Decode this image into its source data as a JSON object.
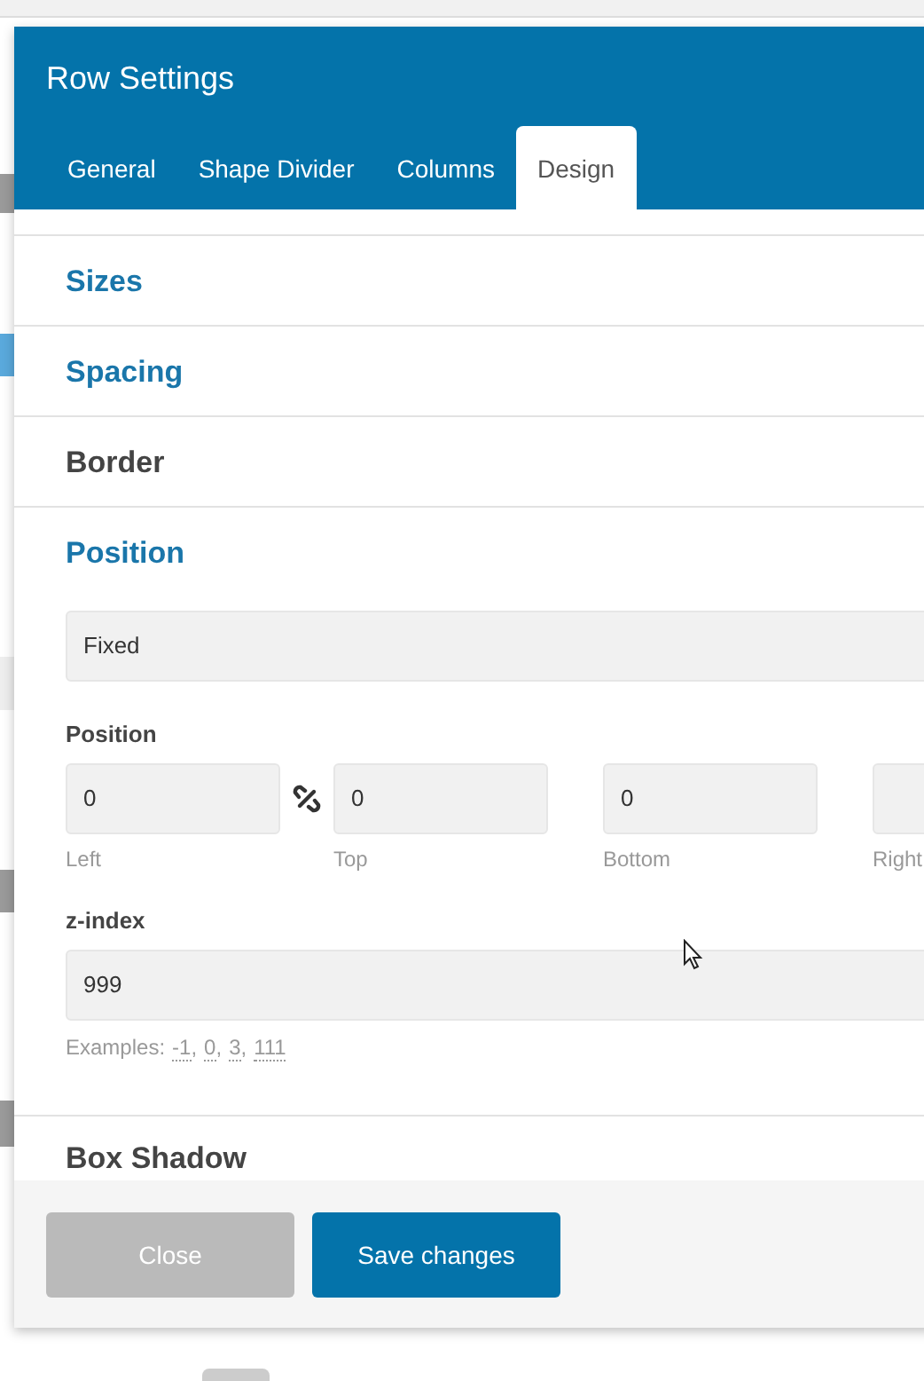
{
  "window": {
    "title": "Row Settings"
  },
  "tabs": [
    {
      "label": "General",
      "selected": false
    },
    {
      "label": "Shape Divider",
      "selected": false
    },
    {
      "label": "Columns",
      "selected": false
    },
    {
      "label": "Design",
      "selected": true
    }
  ],
  "sections": [
    {
      "title": "Sizes",
      "expanded": false,
      "hovered": false
    },
    {
      "title": "Spacing",
      "expanded": false,
      "hovered": false
    },
    {
      "title": "Border",
      "expanded": false,
      "hovered": true
    },
    {
      "title": "Position",
      "expanded": true,
      "hovered": false
    }
  ],
  "position": {
    "type_select": {
      "value": "Fixed"
    },
    "offsets_label": "Position",
    "linked": false,
    "offsets": [
      {
        "label": "Left",
        "value": "0"
      },
      {
        "label": "Top",
        "value": "0"
      },
      {
        "label": "Bottom",
        "value": "0"
      },
      {
        "label": "Right"
      }
    ],
    "z_index": {
      "label": "z-index",
      "value": "999",
      "examples_label": "Examples:",
      "examples": [
        {
          "value": "-1",
          "separator": ","
        },
        {
          "value": "0",
          "separator": ","
        },
        {
          "value": "3",
          "separator": ","
        },
        {
          "value": "111"
        }
      ]
    }
  },
  "next_section": {
    "title": "Box Shadow"
  },
  "buttons": [
    {
      "label": "Close",
      "kind": "secondary"
    },
    {
      "label": "Save changes",
      "kind": "primary"
    }
  ]
}
